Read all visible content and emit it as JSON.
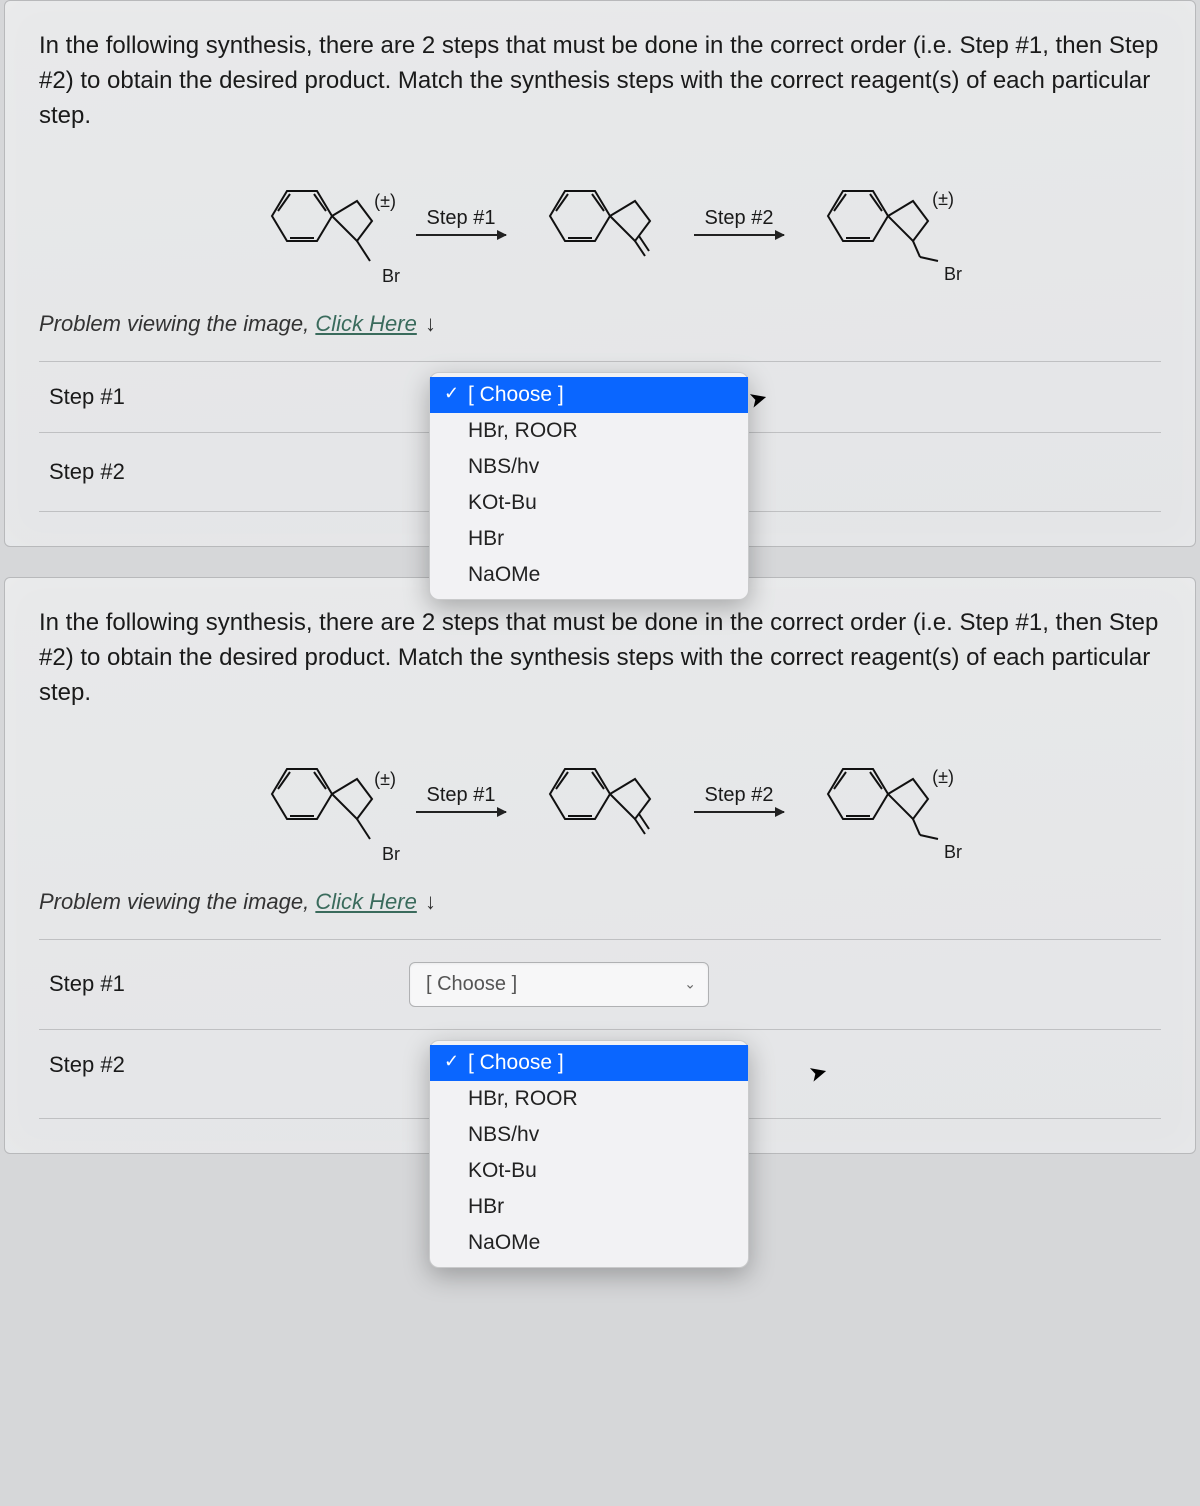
{
  "questions": [
    {
      "prompt": "In the following synthesis, there are 2 steps that must be done in the correct order (i.e. Step #1, then Step #2) to obtain the desired product. Match the synthesis steps with the correct reagent(s) of each particular step.",
      "scheme": {
        "step1_label": "Step #1",
        "step2_label": "Step #2",
        "pm1": "(±)",
        "pm2": "(±)",
        "br1": "Br",
        "br2": "Br"
      },
      "help_text": "Problem viewing the image, ",
      "help_link": "Click Here",
      "rows": [
        {
          "label": "Step #1"
        },
        {
          "label": "Step #2"
        }
      ],
      "dropdown": {
        "open_on": 0,
        "selected": "[ Choose ]",
        "options": [
          "HBr, ROOR",
          "NBS/hv",
          "KOt-Bu",
          "HBr",
          "NaOMe"
        ]
      }
    },
    {
      "prompt": "In the following synthesis, there are 2 steps that must be done in the correct order (i.e. Step #1, then Step #2) to obtain the desired product. Match the synthesis steps with the correct reagent(s) of each particular step.",
      "scheme": {
        "step1_label": "Step #1",
        "step2_label": "Step #2",
        "pm1": "(±)",
        "pm2": "(±)",
        "br1": "Br",
        "br2": "Br"
      },
      "help_text": "Problem viewing the image, ",
      "help_link": "Click Here",
      "rows": [
        {
          "label": "Step #1"
        },
        {
          "label": "Step #2"
        }
      ],
      "closed_select": {
        "on": 0,
        "placeholder": "[ Choose ]"
      },
      "dropdown": {
        "open_on": 1,
        "selected": "[ Choose ]",
        "options": [
          "HBr, ROOR",
          "NBS/hv",
          "KOt-Bu",
          "HBr",
          "NaOMe"
        ]
      }
    }
  ]
}
